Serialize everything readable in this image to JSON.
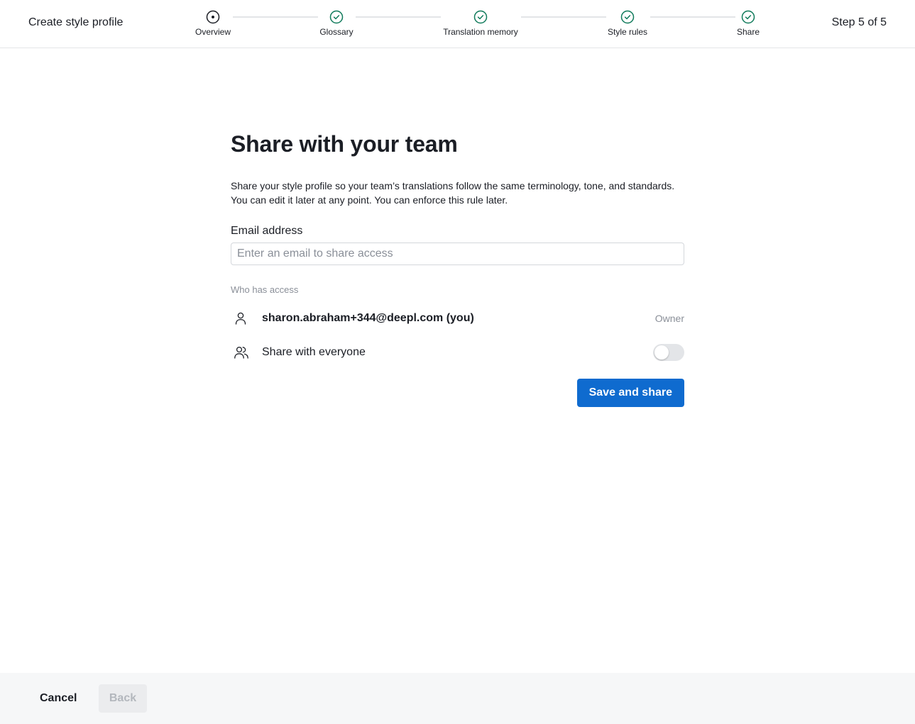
{
  "header": {
    "title": "Create style profile",
    "step_indicator": "Step 5 of 5"
  },
  "stepper": {
    "steps": [
      {
        "label": "Overview",
        "state": "current",
        "icon": "radio-dot-icon"
      },
      {
        "label": "Glossary",
        "state": "complete",
        "icon": "check-circle-icon"
      },
      {
        "label": "Translation memory",
        "state": "complete",
        "icon": "check-circle-icon"
      },
      {
        "label": "Style rules",
        "state": "complete",
        "icon": "check-circle-icon"
      },
      {
        "label": "Share",
        "state": "complete",
        "icon": "check-circle-icon"
      }
    ]
  },
  "main": {
    "title": "Share with your team",
    "description_line1": "Share your style profile so your team’s translations follow the same terminology, tone, and standards.",
    "description_line2": "You can edit it later at any point. You can enforce this rule later.",
    "email": {
      "label": "Email address",
      "placeholder": "Enter an email to share access",
      "value": ""
    },
    "access": {
      "label": "Who has access",
      "owner": {
        "email": "sharon.abraham+344@deepl.com (you)",
        "role": "Owner",
        "icon": "person-icon"
      },
      "everyone": {
        "label": "Share with everyone",
        "enabled": false,
        "icon": "people-icon"
      }
    },
    "submit_label": "Save and share"
  },
  "footer": {
    "cancel_label": "Cancel",
    "back_label": "Back"
  },
  "colors": {
    "accent": "#0f6bcf",
    "complete": "#0f7a5a",
    "border": "#e3e5e8",
    "muted_text": "#8a8f98"
  }
}
